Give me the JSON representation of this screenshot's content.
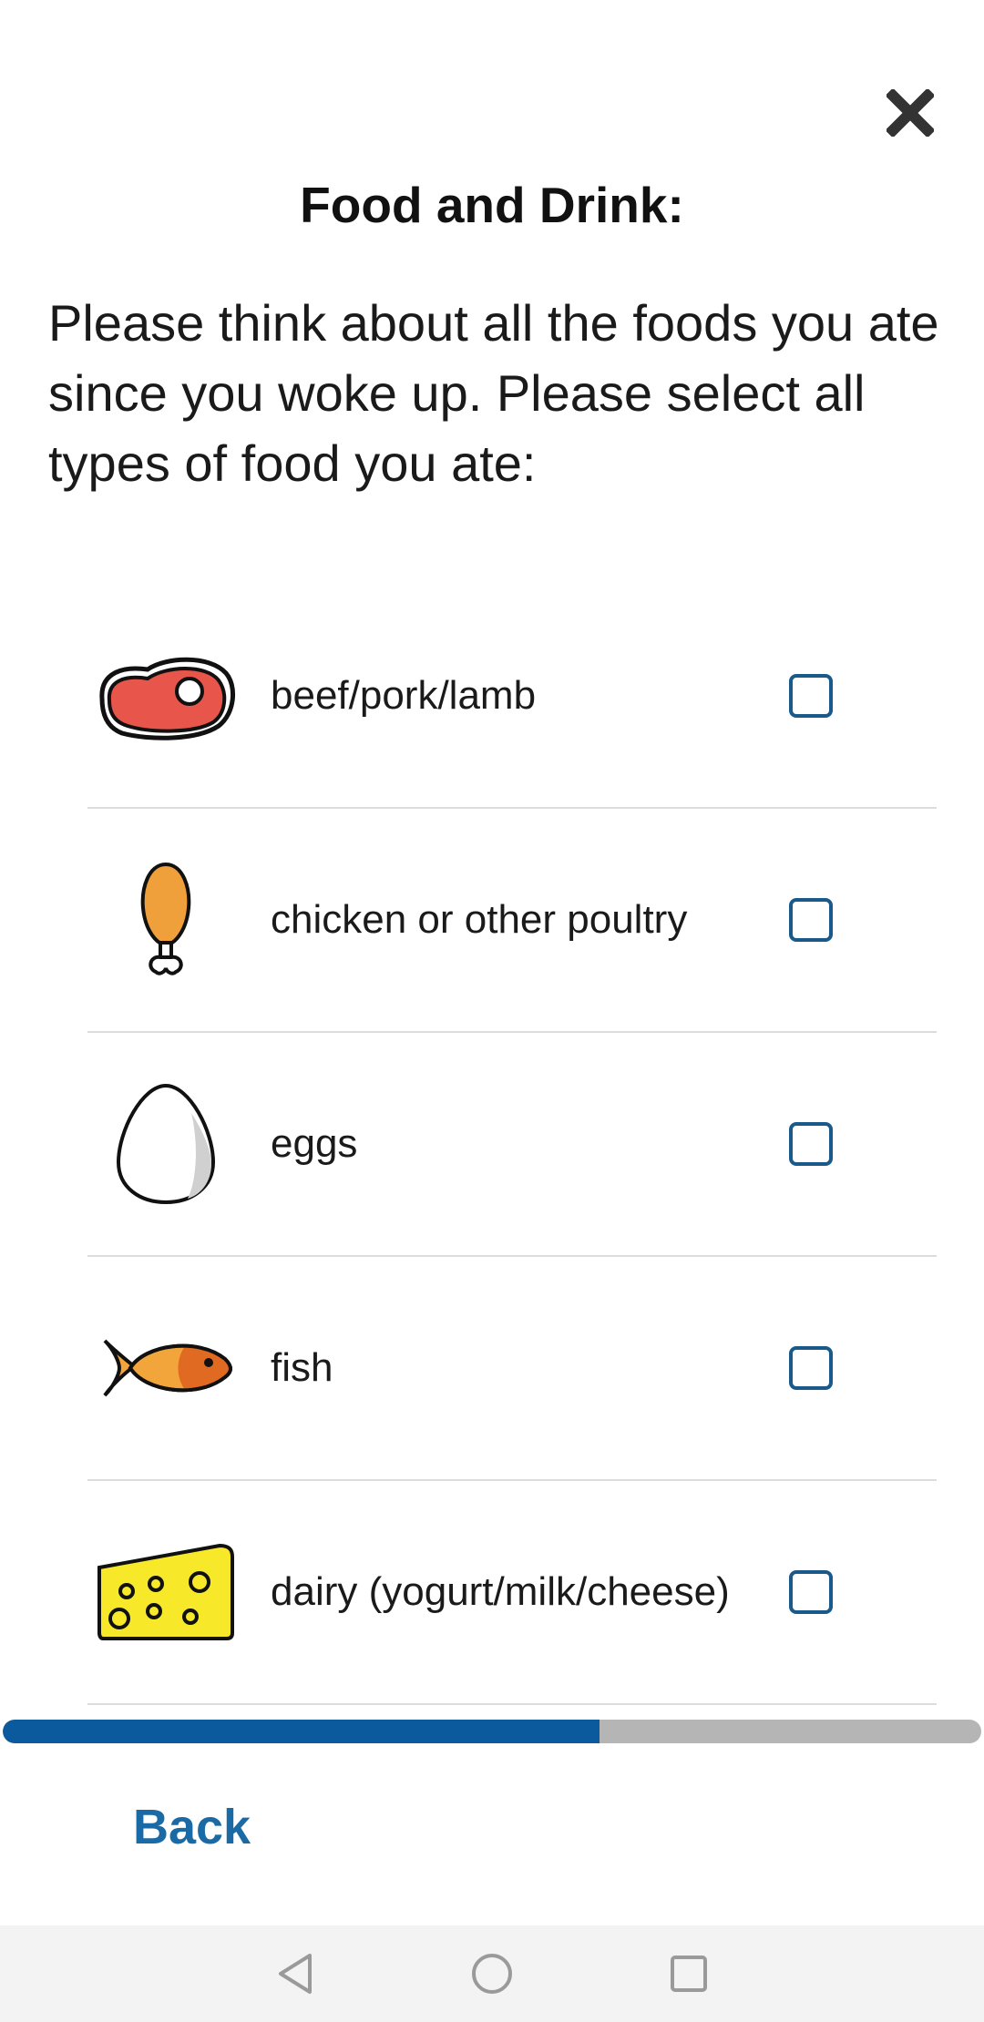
{
  "header": {
    "close_icon": "close-icon",
    "title": "Food and Drink:"
  },
  "prompt": "Please think about all the foods you ate since you woke up. Please select all types of food you ate:",
  "food_items": [
    {
      "label": "beef/pork/lamb",
      "icon": "steak-icon",
      "checked": false
    },
    {
      "label": "chicken or other poultry",
      "icon": "drumstick-icon",
      "checked": false
    },
    {
      "label": "eggs",
      "icon": "egg-icon",
      "checked": false
    },
    {
      "label": "fish",
      "icon": "fish-icon",
      "checked": false
    },
    {
      "label": "dairy (yogurt/milk/cheese)",
      "icon": "cheese-icon",
      "checked": false
    }
  ],
  "progress": {
    "fraction": 0.61,
    "fill_color": "#0b5a9e",
    "track_color": "#b5b5b5"
  },
  "footer": {
    "back_label": "Back"
  },
  "navbar": {
    "back_icon": "nav-back-icon",
    "home_icon": "nav-home-icon",
    "recents_icon": "nav-recents-icon"
  },
  "colors": {
    "accent": "#1a6aa5",
    "checkbox_border": "#1a5a8a"
  }
}
